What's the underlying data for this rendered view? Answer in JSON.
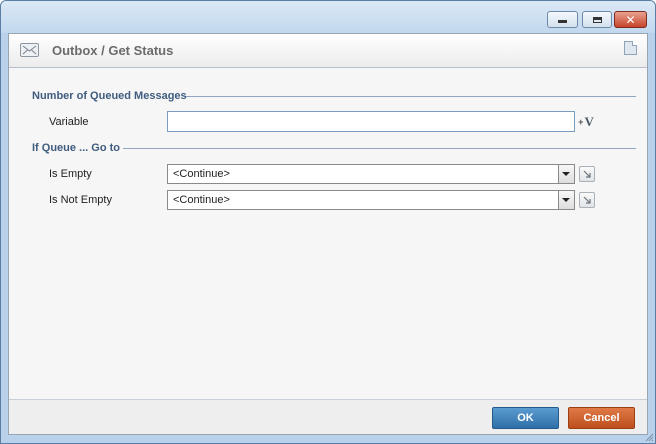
{
  "window": {
    "controls": {
      "minimize_icon": "minimize-icon",
      "maximize_icon": "maximize-icon",
      "close_icon": "close-icon",
      "close_glyph": "✕"
    }
  },
  "header": {
    "icon": "envelope-icon",
    "title": "Outbox / Get Status",
    "note_icon": "note-icon"
  },
  "sections": {
    "queued": {
      "heading": "Number of Queued Messages",
      "variable_label": "Variable",
      "variable_value": "",
      "variable_button_icon": "insert-variable-icon",
      "variable_button_label": "V",
      "variable_button_prefix": "+"
    },
    "queue_goto": {
      "heading": "If Queue ... Go to",
      "is_empty_label": "Is Empty",
      "is_empty_value": "<Continue>",
      "is_not_empty_label": "Is Not Empty",
      "is_not_empty_value": "<Continue>",
      "goto_icon": "goto-arrow-icon"
    }
  },
  "footer": {
    "ok_label": "OK",
    "cancel_label": "Cancel"
  },
  "colors": {
    "section_heading": "#3f5c7f",
    "ok_button": "#3b7fbd",
    "cancel_button": "#cf5f2e",
    "window_frame": "#b9d1ea"
  }
}
